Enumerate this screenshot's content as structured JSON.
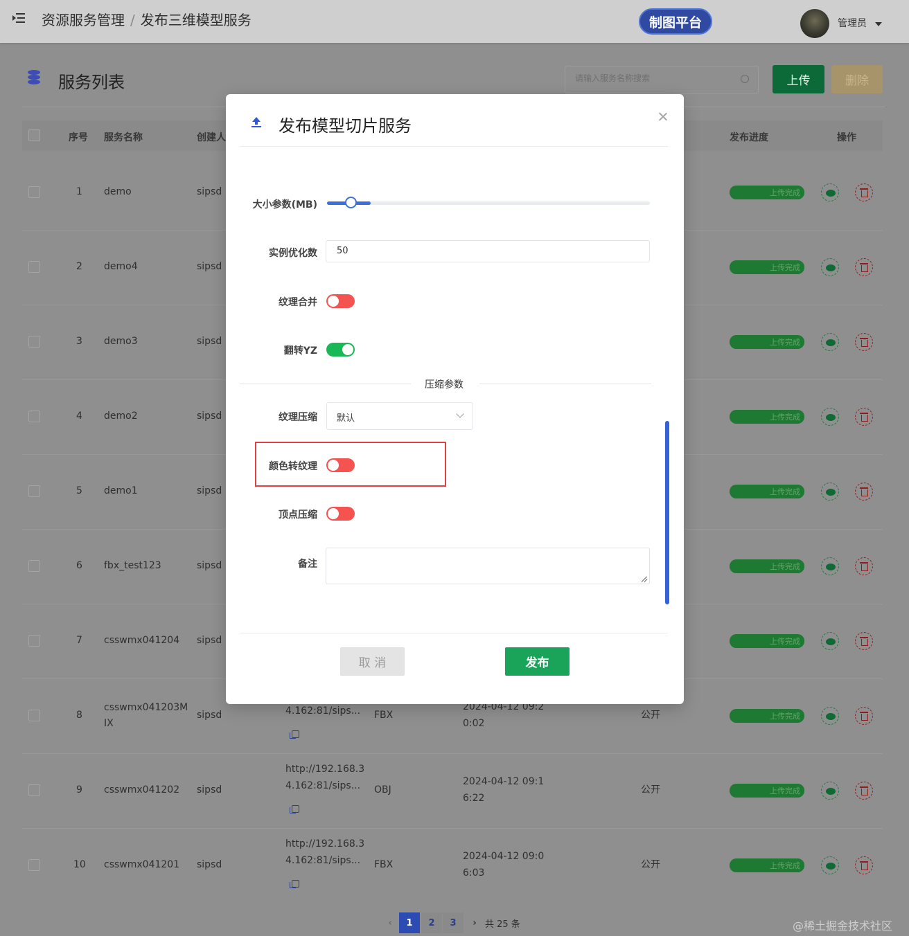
{
  "header": {
    "breadcrumb": [
      "资源服务管理",
      "发布三维模型服务"
    ],
    "breadcrumb_sep": "/",
    "platform_button": "制图平台",
    "user_name": "管理员"
  },
  "list": {
    "title": "服务列表",
    "search_placeholder": "请输入服务名称搜索",
    "upload_button": "上传",
    "delete_button": "删除",
    "columns": {
      "index": "序号",
      "name": "服务名称",
      "creator": "创建人",
      "progress": "发布进度",
      "actions": "操作"
    },
    "rows": [
      {
        "index": "1",
        "name": "demo",
        "creator": "sipsd",
        "progress_label": "上传完成",
        "progress": 100
      },
      {
        "index": "2",
        "name": "demo4",
        "creator": "sipsd",
        "progress_label": "上传完成",
        "progress": 100
      },
      {
        "index": "3",
        "name": "demo3",
        "creator": "sipsd",
        "progress_label": "上传完成",
        "progress": 100
      },
      {
        "index": "4",
        "name": "demo2",
        "creator": "sipsd",
        "progress_label": "上传完成",
        "progress": 100
      },
      {
        "index": "5",
        "name": "demo1",
        "creator": "sipsd",
        "progress_label": "上传完成",
        "progress": 100
      },
      {
        "index": "6",
        "name": "fbx_test123",
        "creator": "sipsd",
        "progress_label": "上传完成",
        "progress": 100
      },
      {
        "index": "7",
        "name": "csswmx041204",
        "creator": "sipsd",
        "progress_label": "上传完成",
        "progress": 100
      },
      {
        "index": "8",
        "name_l1": "csswmx041203M",
        "name_l2": "IX",
        "creator": "sipsd",
        "url_l2": "4.162:81/sips...",
        "format": "FBX",
        "date_l1": "2024-04-12 09:2",
        "date_l2": "0:02",
        "access": "公开",
        "progress_label": "上传完成",
        "progress": 100
      },
      {
        "index": "9",
        "name": "csswmx041202",
        "creator": "sipsd",
        "url_l1": "http://192.168.3",
        "url_l2": "4.162:81/sips...",
        "format": "OBJ",
        "date_l1": "2024-04-12 09:1",
        "date_l2": "6:22",
        "access": "公开",
        "progress_label": "上传完成",
        "progress": 100
      },
      {
        "index": "10",
        "name": "csswmx041201",
        "creator": "sipsd",
        "url_l1": "http://192.168.3",
        "url_l2": "4.162:81/sips...",
        "format": "FBX",
        "date_l1": "2024-04-12 09:0",
        "date_l2": "6:03",
        "access": "公开",
        "progress_label": "上传完成",
        "progress": 100
      }
    ],
    "pagination": {
      "pages": [
        "1",
        "2",
        "3"
      ],
      "current": "1",
      "total": "共 25 条"
    }
  },
  "modal": {
    "title": "发布模型切片服务",
    "size_param_label": "大小参数(MB)",
    "size_param_fraction": 0.08,
    "instance_opt_label": "实例优化数",
    "instance_opt_value": "50",
    "texture_merge_label": "纹理合并",
    "texture_merge_on": false,
    "flip_yz_label": "翻转YZ",
    "flip_yz_on": true,
    "compression_divider": "压缩参数",
    "texture_compress_label": "纹理压缩",
    "texture_compress_value": "默认",
    "color_to_texture_label": "颜色转纹理",
    "color_to_texture_on": false,
    "vertex_compress_label": "顶点压缩",
    "vertex_compress_on": false,
    "remark_label": "备注",
    "remark_value": "",
    "cancel_button": "取 消",
    "publish_button": "发布"
  },
  "watermark": "@稀土掘金技术社区",
  "colors": {
    "primary_blue": "#3b6fe0",
    "success_green": "#18b857",
    "switch_off_red": "#f45350",
    "highlight_red": "#e14040"
  }
}
